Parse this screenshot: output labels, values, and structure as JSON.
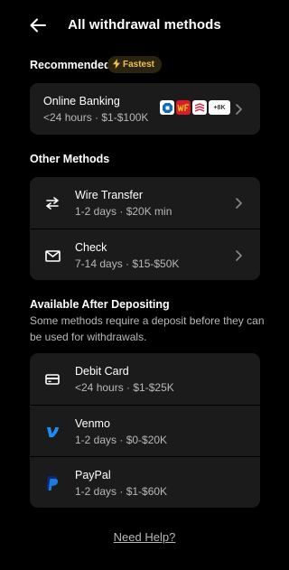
{
  "header": {
    "title": "All withdrawal methods"
  },
  "recommended": {
    "title": "Recommended",
    "badge": "Fastest",
    "item": {
      "name": "Online Banking",
      "meta": "<24 hours · $1-$100K",
      "bank_more": "+8K"
    }
  },
  "other": {
    "title": "Other Methods",
    "items": [
      {
        "name": "Wire Transfer",
        "meta": "1-2 days · $20K min",
        "icon": "transfer-arrows-icon"
      },
      {
        "name": "Check",
        "meta": "7-14 days · $15-$50K",
        "icon": "envelope-icon"
      }
    ]
  },
  "after_deposit": {
    "title": "Available After Depositing",
    "subtext": "Some methods require a deposit before they can be used for withdrawals.",
    "items": [
      {
        "name": "Debit Card",
        "meta": "<24 hours · $1-$25K",
        "icon": "card-icon"
      },
      {
        "name": "Venmo",
        "meta": "1-2 days · $0-$20K",
        "icon": "venmo-icon"
      },
      {
        "name": "PayPal",
        "meta": "1-2 days · $1-$60K",
        "icon": "paypal-icon"
      }
    ]
  },
  "footer": {
    "help": "Need Help?"
  },
  "colors": {
    "background": "#000000",
    "card": "#1b1b1b",
    "badge_text": "#f2c14e",
    "venmo": "#1c8cf7",
    "paypal": "#0a2a7a"
  }
}
